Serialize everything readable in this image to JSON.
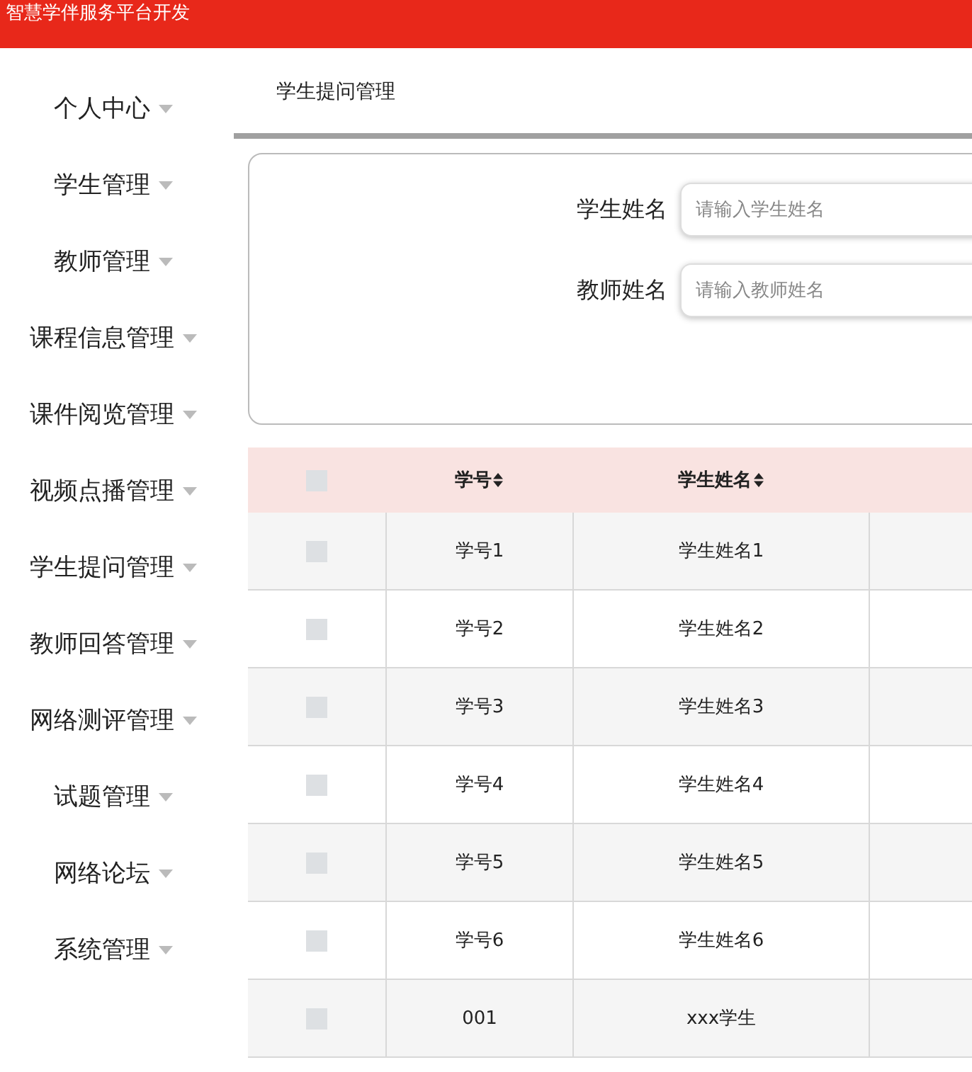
{
  "header": {
    "title": "智慧学伴服务平台开发"
  },
  "sidebar": {
    "items": [
      {
        "label": "个人中心"
      },
      {
        "label": "学生管理"
      },
      {
        "label": "教师管理"
      },
      {
        "label": "课程信息管理"
      },
      {
        "label": "课件阅览管理"
      },
      {
        "label": "视频点播管理"
      },
      {
        "label": "学生提问管理"
      },
      {
        "label": "教师回答管理"
      },
      {
        "label": "网络测评管理"
      },
      {
        "label": "试题管理"
      },
      {
        "label": "网络论坛"
      },
      {
        "label": "系统管理"
      }
    ]
  },
  "breadcrumb": "学生提问管理",
  "search": {
    "fields": [
      {
        "label": "学生姓名",
        "placeholder": "请输入学生姓名"
      },
      {
        "label": "教师姓名",
        "placeholder": "请输入教师姓名"
      }
    ]
  },
  "table": {
    "select_all_checked": false,
    "columns": [
      "学号",
      "学生姓名"
    ],
    "rows": [
      {
        "checked": false,
        "cells": [
          "学号1",
          "学生姓名1"
        ]
      },
      {
        "checked": false,
        "cells": [
          "学号2",
          "学生姓名2"
        ]
      },
      {
        "checked": false,
        "cells": [
          "学号3",
          "学生姓名3"
        ]
      },
      {
        "checked": false,
        "cells": [
          "学号4",
          "学生姓名4"
        ]
      },
      {
        "checked": false,
        "cells": [
          "学号5",
          "学生姓名5"
        ]
      },
      {
        "checked": false,
        "cells": [
          "学号6",
          "学生姓名6"
        ]
      },
      {
        "checked": false,
        "cells": [
          "001",
          "xxx学生"
        ]
      }
    ]
  }
}
